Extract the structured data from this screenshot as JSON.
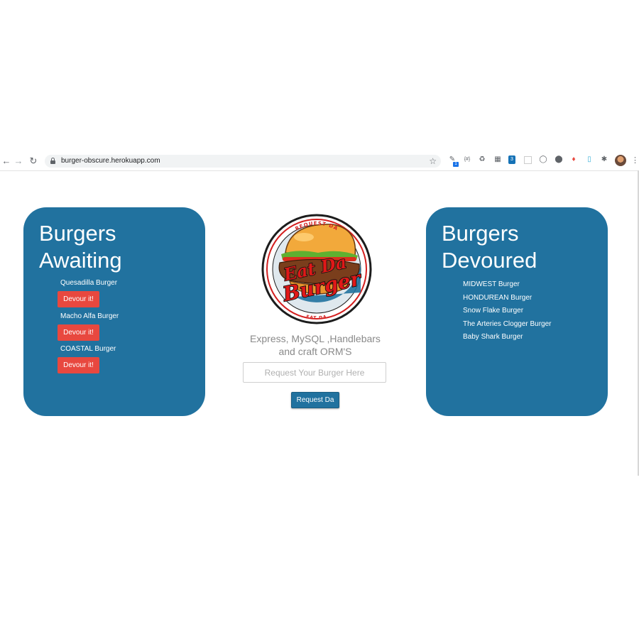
{
  "browser": {
    "url": "burger-obscure.herokuapp.com",
    "nav_icons": [
      "back-arrow-icon",
      "forward-arrow-icon",
      "reload-icon"
    ],
    "extension_icons": [
      "eyedropper-icon",
      "json-icon",
      "recycle-icon",
      "qr-icon",
      "css-icon",
      "blank-page-icon",
      "shield-icon",
      "circle-icon",
      "tag-icon",
      "document-icon",
      "puzzle-icon"
    ],
    "extension_badge": "1"
  },
  "awaiting": {
    "title_line1": "Burgers",
    "title_line2": "Awaiting",
    "items": [
      {
        "name": "Quesadilla Burger",
        "button": "Devour it!"
      },
      {
        "name": "Macho Alfa Burger",
        "button": "Devour it!"
      },
      {
        "name": "COASTAL Burger",
        "button": "Devour it!"
      }
    ]
  },
  "logo": {
    "top_text": "REQUEST DA",
    "main_line1": "Eat Da",
    "main_line2": "Burger",
    "bottom_text": "EAT DA"
  },
  "center": {
    "subtitle_line1": "Express, MySQL ,Handlebars",
    "subtitle_line2": "and craft ORM'S",
    "input_placeholder": "Request Your Burger Here",
    "button_label": "Request Da"
  },
  "devoured": {
    "title_line1": "Burgers",
    "title_line2": "Devoured",
    "items": [
      "MIDWEST Burger",
      "HONDUREAN Burger",
      "Snow Flake Burger",
      "The Arteries Clogger Burger",
      "Baby Shark Burger"
    ]
  },
  "colors": {
    "panel": "#21729f",
    "devour_button": "#e8483f",
    "logo_red": "#d42020"
  }
}
